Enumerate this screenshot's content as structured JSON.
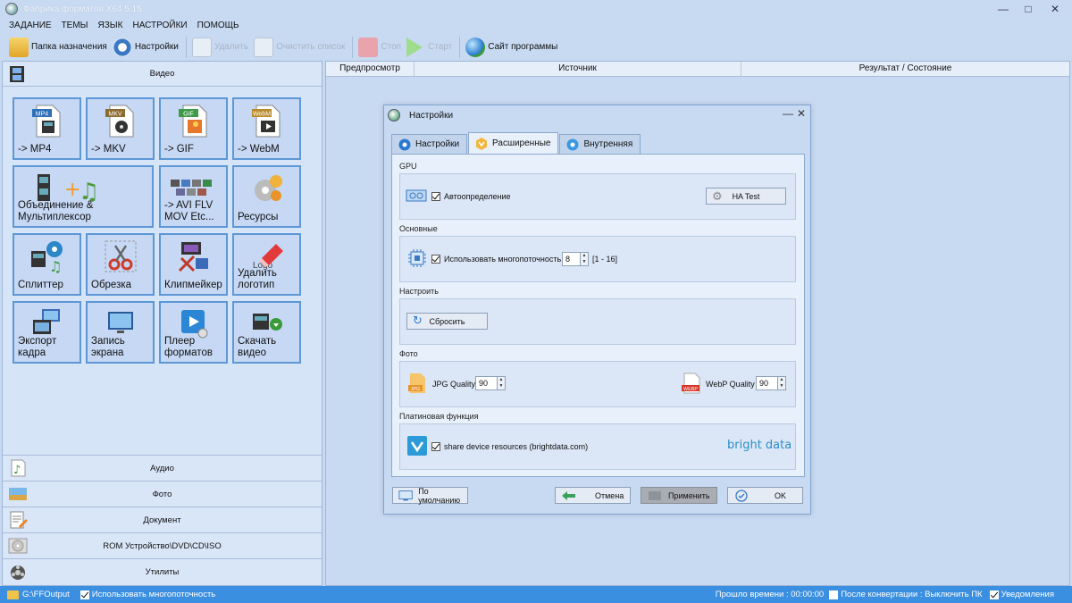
{
  "window": {
    "title": "Фабрика форматов X64 5.15"
  },
  "menu": [
    "ЗАДАНИЕ",
    "ТЕМЫ",
    "ЯЗЫК",
    "НАСТРОЙКИ",
    "ПОМОЩЬ"
  ],
  "toolbar": {
    "dest_folder": "Папка назначения",
    "settings": "Настройки",
    "delete": "Удалить",
    "clear_list": "Очистить список",
    "stop": "Стоп",
    "start": "Старт",
    "website": "Сайт программы"
  },
  "left": {
    "video_header": "Видео",
    "tiles": [
      {
        "label": "-> MP4"
      },
      {
        "label": "-> MKV"
      },
      {
        "label": "-> GIF"
      },
      {
        "label": "-> WebM"
      },
      {
        "label": "Объединение &\nМультиплексор"
      },
      {
        "label": "-> AVI FLV\nMOV Etc..."
      },
      {
        "label": "Ресурсы"
      },
      {
        "label": "Сплиттер"
      },
      {
        "label": "Обрезка"
      },
      {
        "label": "Клипмейкер"
      },
      {
        "label": "Удалить\nлоготип"
      },
      {
        "label": "Экспорт\nкадра"
      },
      {
        "label": "Запись\nэкрана"
      },
      {
        "label": "Плеер\nформатов"
      },
      {
        "label": "Скачать\nвидео"
      }
    ],
    "badges": {
      "mp4": "MP4",
      "mkv": "MKV",
      "gif": "GIF",
      "webm": "WebM",
      "logo": "Logo"
    },
    "categories": [
      "Аудио",
      "Фото",
      "Документ",
      "ROM Устройство\\DVD\\CD\\ISO",
      "Утилиты"
    ]
  },
  "table": {
    "col_preview": "Предпросмотр",
    "col_source": "Источник",
    "col_result": "Результат / Состояние"
  },
  "dialog": {
    "title": "Настройки",
    "tabs": [
      "Настройки",
      "Расширенные",
      "Внутренняя"
    ],
    "gpu": {
      "title": "GPU",
      "auto": "Автоопределение",
      "ha_test": "HA Test"
    },
    "basic": {
      "title": "Основные",
      "multithread": "Использовать многопоточность",
      "threads": "8",
      "range": "[1 - 16]"
    },
    "adjust": {
      "title": "Настроить",
      "reset": "Сбросить"
    },
    "photo": {
      "title": "Фото",
      "jpg_label": "JPG Quality",
      "jpg_value": "90",
      "webp_label": "WebP Quality",
      "webp_value": "90",
      "jpg_badge": "JPG",
      "webp_badge": "WEBP"
    },
    "premium": {
      "title": "Платиновая функция",
      "share": "share device resources (brightdata.com)",
      "brand": "bright data"
    },
    "footer": {
      "default": "По умолчанию",
      "cancel": "Отмена",
      "apply": "Применить",
      "ok": "OK"
    }
  },
  "status": {
    "path": "G:\\FFOutput",
    "multithread": "Использовать многопоточность",
    "elapsed": "Прошло времени : 00:00:00",
    "after": "После конвертации : Выключить ПК",
    "notify": "Уведомления"
  }
}
